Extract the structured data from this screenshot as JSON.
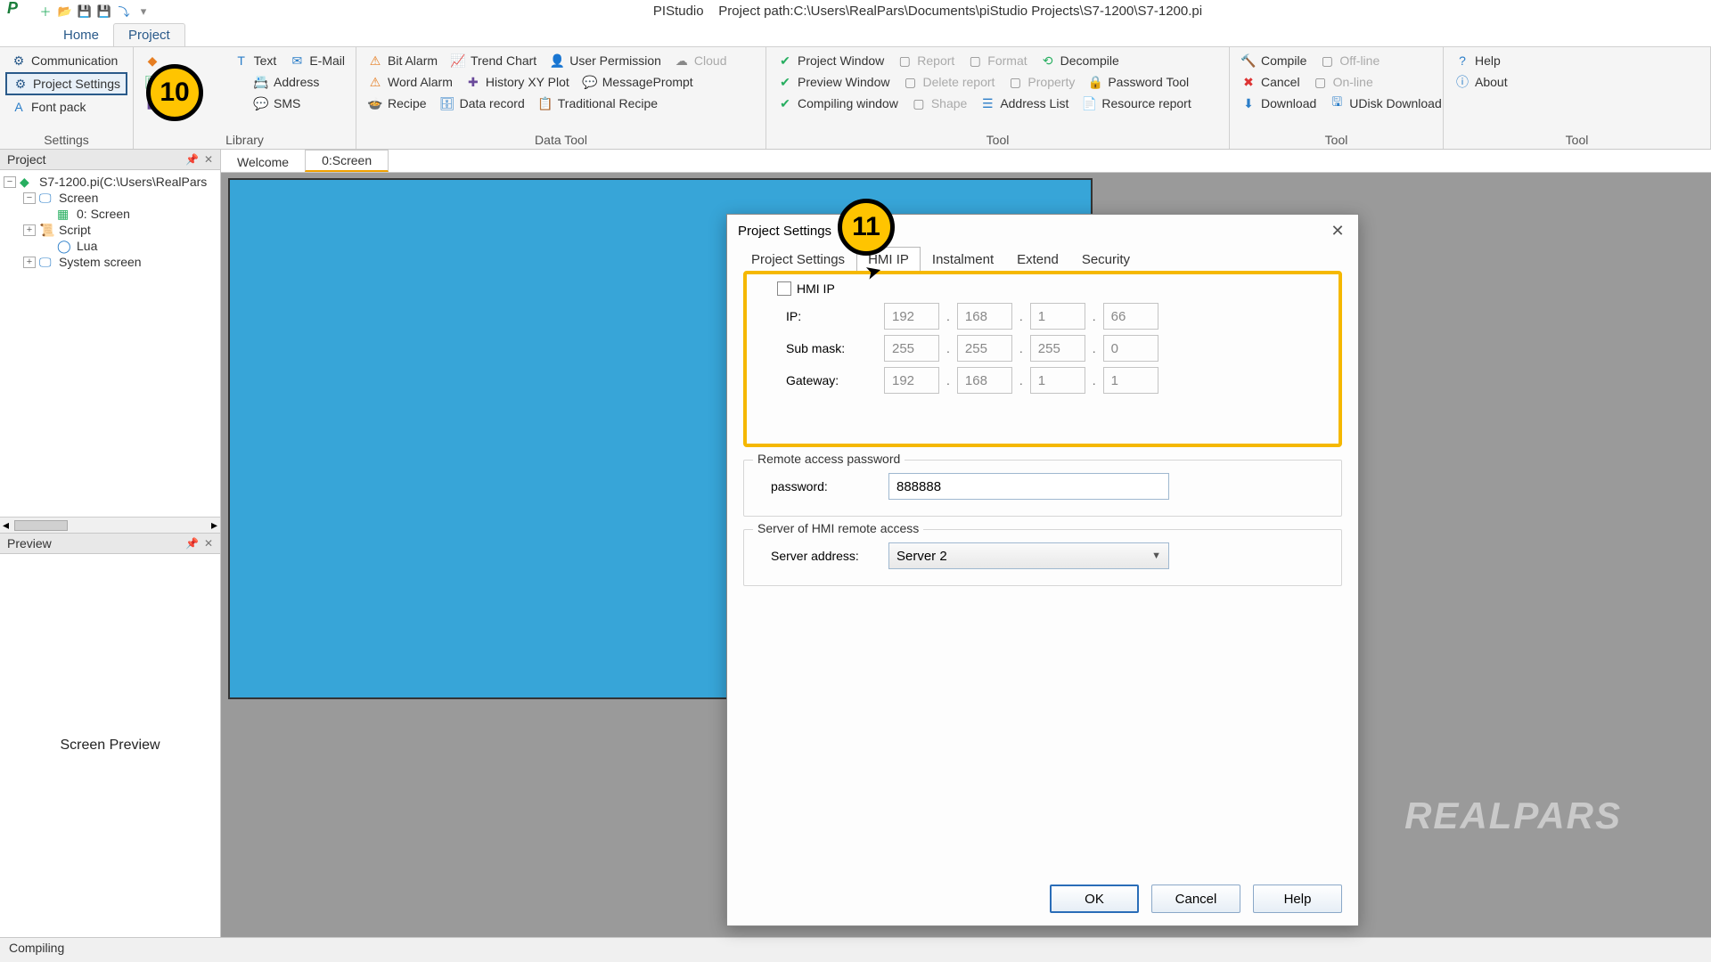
{
  "title": {
    "app": "PIStudio",
    "path_label": "Project path:",
    "path": "C:\\Users\\RealPars\\Documents\\piStudio Projects\\S7-1200\\S7-1200.pi"
  },
  "menu_tabs": {
    "home": "Home",
    "project": "Project"
  },
  "ribbon": {
    "settings": {
      "label": "Settings",
      "communication": "Communication",
      "project_settings": "Project Settings",
      "font_pack": "Font pack"
    },
    "library": {
      "label": "Library",
      "text": "Text",
      "email": "E-Mail",
      "address": "Address",
      "sms": "SMS"
    },
    "data_tool": {
      "label": "Data Tool",
      "bit_alarm": "Bit Alarm",
      "trend_chart": "Trend Chart",
      "user_permission": "User Permission",
      "cloud": "Cloud",
      "word_alarm": "Word Alarm",
      "history_xy": "History XY Plot",
      "message_prompt": "MessagePrompt",
      "recipe": "Recipe",
      "data_record": "Data record",
      "trad_recipe": "Traditional Recipe"
    },
    "tool1": {
      "label": "Tool",
      "project_window": "Project Window",
      "report": "Report",
      "format": "Format",
      "decompile": "Decompile",
      "preview_window": "Preview Window",
      "delete_report": "Delete report",
      "property": "Property",
      "password_tool": "Password Tool",
      "compiling_window": "Compiling window",
      "shape": "Shape",
      "address_list": "Address List",
      "resource_report": "Resource report"
    },
    "tool2": {
      "label": "Tool",
      "compile": "Compile",
      "offline": "Off-line",
      "cancel": "Cancel",
      "online": "On-line",
      "download": "Download",
      "udisk": "UDisk Download"
    },
    "tool3": {
      "label": "Tool",
      "help": "Help",
      "about": "About"
    }
  },
  "project_panel": {
    "title": "Project",
    "root": "S7-1200.pi(C:\\Users\\RealPars",
    "screen": "Screen",
    "screen0": "0: Screen",
    "script": "Script",
    "lua": "Lua",
    "system_screen": "System screen"
  },
  "preview_panel": {
    "title": "Preview",
    "body": "Screen Preview"
  },
  "doc_tabs": {
    "welcome": "Welcome",
    "screen0": "0:Screen"
  },
  "status": "Compiling",
  "dialog": {
    "title": "Project Settings",
    "tabs": {
      "project_settings": "Project Settings",
      "hmi_ip": "HMI IP",
      "instalment": "Instalment",
      "extend": "Extend",
      "security": "Security"
    },
    "hmi_ip_check": "HMI IP",
    "ip_label": "IP:",
    "ip": [
      "192",
      "168",
      "1",
      "66"
    ],
    "mask_label": "Sub mask:",
    "mask": [
      "255",
      "255",
      "255",
      "0"
    ],
    "gw_label": "Gateway:",
    "gw": [
      "192",
      "168",
      "1",
      "1"
    ],
    "remote_group": "Remote access password",
    "password_label": "password:",
    "password": "888888",
    "server_group": "Server of HMI remote access",
    "server_label": "Server address:",
    "server_value": "Server 2",
    "ok": "OK",
    "cancel": "Cancel",
    "help": "Help"
  },
  "badges": {
    "b10": "10",
    "b11": "11"
  },
  "watermark": "REALPARS"
}
